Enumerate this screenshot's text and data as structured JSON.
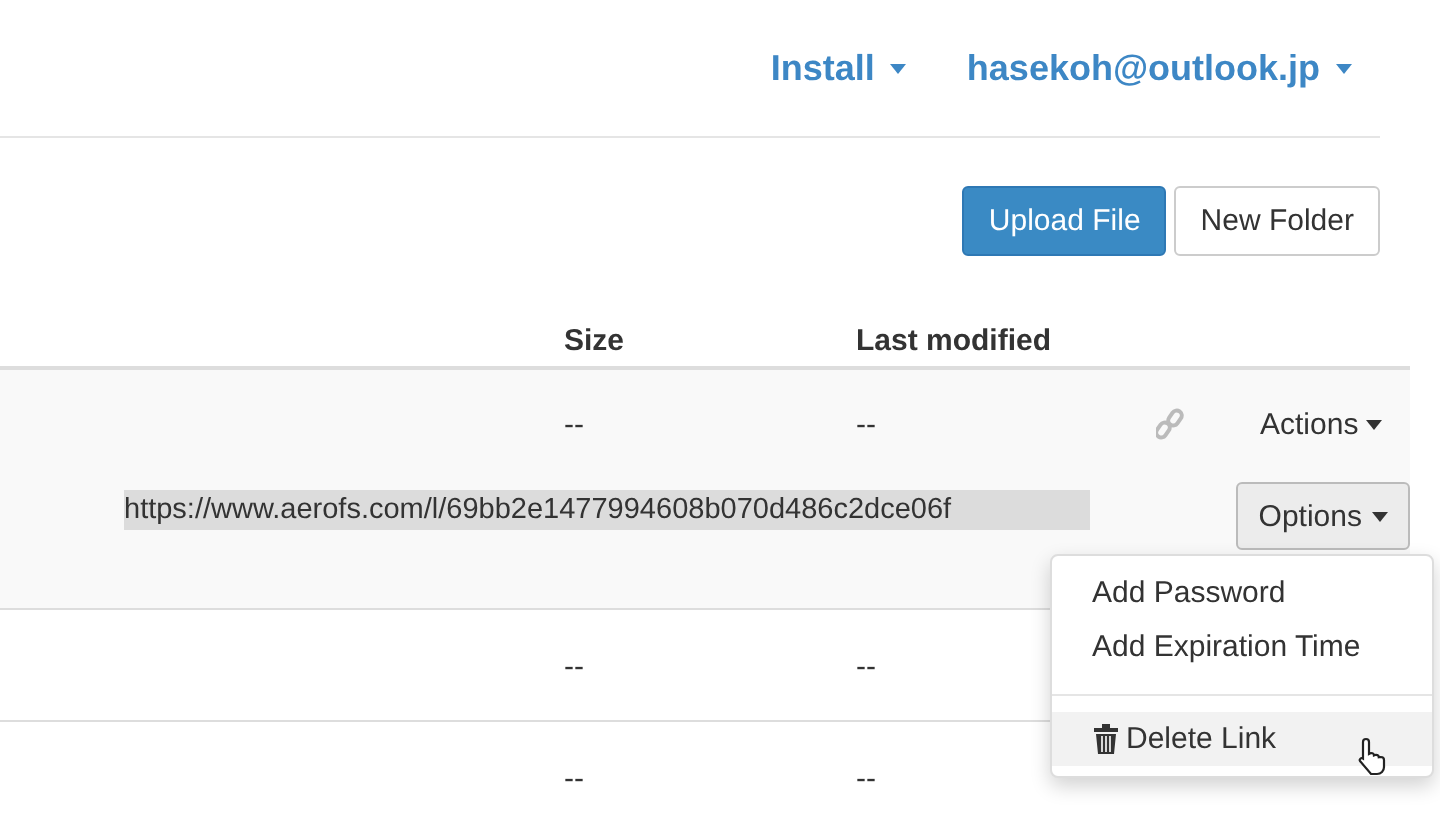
{
  "nav": [
    {
      "label": "Install"
    },
    {
      "label": "hasekoh@outlook.jp"
    }
  ],
  "toolbar": [
    {
      "label": "Upload File",
      "kind": "primary"
    },
    {
      "label": "New Folder",
      "kind": "default"
    }
  ],
  "table": {
    "columns": [
      "Size",
      "Last modified"
    ],
    "rows": [
      {
        "size": "--",
        "modified": "--",
        "expanded": true,
        "shared": true,
        "actions": "Actions",
        "link": {
          "url": "https://www.aerofs.com/l/69bb2e1477994608b070d486c2dce06f",
          "options": "Options"
        }
      },
      {
        "size": "--",
        "modified": "--",
        "expanded": false,
        "shared": false
      },
      {
        "size": "--",
        "modified": "--",
        "expanded": false,
        "shared": false
      }
    ]
  },
  "menu": {
    "items": [
      {
        "kind": "item",
        "label": "Add Password",
        "selected": false
      },
      {
        "kind": "item",
        "label": "Add Expiration Time",
        "selected": false
      },
      {
        "kind": "divider"
      },
      {
        "kind": "delete",
        "label": "Delete Link",
        "selected": true
      }
    ]
  }
}
